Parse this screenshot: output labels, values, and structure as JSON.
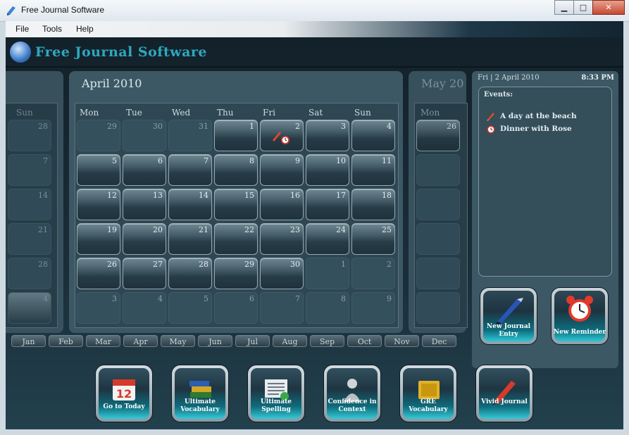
{
  "window": {
    "title": "Free Journal Software",
    "minimize_glyph": "▁",
    "maximize_glyph": "□",
    "close_glyph": "✕"
  },
  "menu": [
    "File",
    "Tools",
    "Help"
  ],
  "header": {
    "app_title": "Free Journal Software"
  },
  "calendar": {
    "current_month": "April 2010",
    "next_month": "May 2010",
    "next_month_visible": "May 20",
    "weekdays": [
      "Mon",
      "Tue",
      "Wed",
      "Thu",
      "Fri",
      "Sat",
      "Sun"
    ],
    "cells": [
      {
        "n": "29",
        "cur": false
      },
      {
        "n": "30",
        "cur": false
      },
      {
        "n": "31",
        "cur": false
      },
      {
        "n": "1",
        "cur": true
      },
      {
        "n": "2",
        "cur": true,
        "selected": true
      },
      {
        "n": "3",
        "cur": true
      },
      {
        "n": "4",
        "cur": true
      },
      {
        "n": "5",
        "cur": true
      },
      {
        "n": "6",
        "cur": true
      },
      {
        "n": "7",
        "cur": true
      },
      {
        "n": "8",
        "cur": true
      },
      {
        "n": "9",
        "cur": true
      },
      {
        "n": "10",
        "cur": true
      },
      {
        "n": "11",
        "cur": true
      },
      {
        "n": "12",
        "cur": true
      },
      {
        "n": "13",
        "cur": true
      },
      {
        "n": "14",
        "cur": true
      },
      {
        "n": "15",
        "cur": true
      },
      {
        "n": "16",
        "cur": true
      },
      {
        "n": "17",
        "cur": true
      },
      {
        "n": "18",
        "cur": true
      },
      {
        "n": "19",
        "cur": true
      },
      {
        "n": "20",
        "cur": true
      },
      {
        "n": "21",
        "cur": true
      },
      {
        "n": "22",
        "cur": true
      },
      {
        "n": "23",
        "cur": true
      },
      {
        "n": "24",
        "cur": true
      },
      {
        "n": "25",
        "cur": true
      },
      {
        "n": "26",
        "cur": true
      },
      {
        "n": "27",
        "cur": true
      },
      {
        "n": "28",
        "cur": true
      },
      {
        "n": "29",
        "cur": true
      },
      {
        "n": "30",
        "cur": true
      },
      {
        "n": "1",
        "cur": false
      },
      {
        "n": "2",
        "cur": false
      },
      {
        "n": "3",
        "cur": false
      },
      {
        "n": "4",
        "cur": false
      },
      {
        "n": "5",
        "cur": false
      },
      {
        "n": "6",
        "cur": false
      },
      {
        "n": "7",
        "cur": false
      },
      {
        "n": "8",
        "cur": false
      },
      {
        "n": "9",
        "cur": false
      }
    ],
    "prev_month_sun_label": "Sun",
    "prev_month_sundays": [
      "28",
      "7",
      "14",
      "21",
      "28",
      "4"
    ],
    "next_month_mon_label": "Mon",
    "next_month_mondays": [
      "26"
    ]
  },
  "months": [
    "Jan",
    "Feb",
    "Mar",
    "Apr",
    "May",
    "Jun",
    "Jul",
    "Aug",
    "Sep",
    "Oct",
    "Nov",
    "Dec"
  ],
  "side": {
    "date": "Fri | 2 April 2010",
    "time": "8:33 PM",
    "events_label": "Events:",
    "events": [
      {
        "icon": "pencil-icon",
        "text": "A day at the beach"
      },
      {
        "icon": "alarm-clock-icon",
        "text": "Dinner with Rose"
      }
    ],
    "new_entry_label": "New Journal Entry",
    "new_reminder_label": "New Reminder"
  },
  "tools": [
    {
      "label": "Go to Today",
      "icon": "calendar-today-icon"
    },
    {
      "label": "Ultimate Vocabulary",
      "icon": "books-icon"
    },
    {
      "label": "Ultimate Spelling",
      "icon": "spelling-sheet-icon"
    },
    {
      "label": "Confidence in Context",
      "icon": "context-figure-icon"
    },
    {
      "label": "GRE Vocabulary",
      "icon": "gre-book-icon"
    },
    {
      "label": "Vivid Journal",
      "icon": "pen-icon"
    }
  ],
  "colors": {
    "accent": "#2ea8c0",
    "panel": "#3d5865",
    "app_bg": "#1a2e39"
  }
}
